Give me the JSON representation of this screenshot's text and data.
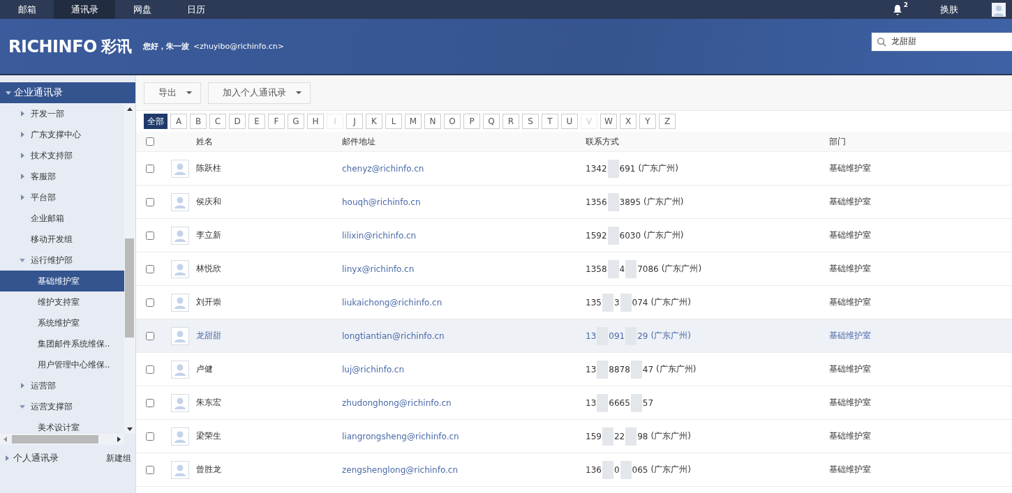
{
  "top_nav": [
    {
      "label": "邮箱",
      "selected": false
    },
    {
      "label": "通讯录",
      "selected": true
    },
    {
      "label": "网盘",
      "selected": false
    },
    {
      "label": "日历",
      "selected": false
    }
  ],
  "notifications": {
    "count": "2"
  },
  "skin_label": "换肤",
  "header": {
    "logo": "RICHINFO",
    "logo_cn": "彩讯",
    "greeting": "您好，朱一波",
    "email": "<zhuyibo@richinfo.cn>"
  },
  "search": {
    "value": "龙甜甜"
  },
  "sidebar": {
    "title": "企业通讯录",
    "expanded": true,
    "items": [
      {
        "label": "开发一部",
        "expanded": false,
        "selected": false
      },
      {
        "label": "广东支撑中心",
        "expanded": false,
        "selected": false
      },
      {
        "label": "技术支持部",
        "expanded": false,
        "selected": false
      },
      {
        "label": "客服部",
        "expanded": false,
        "selected": false
      },
      {
        "label": "平台部",
        "expanded": false,
        "selected": false
      },
      {
        "label": "企业邮箱",
        "selected": false
      },
      {
        "label": "移动开发组",
        "selected": false
      },
      {
        "label": "运行维护部",
        "expanded": true,
        "selected": false,
        "children": [
          {
            "label": "基础维护室",
            "selected": true
          },
          {
            "label": "维护支持室",
            "selected": false
          },
          {
            "label": "系统维护室",
            "selected": false
          },
          {
            "label": "集团邮件系统维保..",
            "selected": false
          },
          {
            "label": "用户管理中心维保..",
            "selected": false
          }
        ]
      },
      {
        "label": "运营部",
        "expanded": false,
        "selected": false
      },
      {
        "label": "运营支撑部",
        "expanded": true,
        "selected": false,
        "children": [
          {
            "label": "美术设计室",
            "selected": false
          }
        ]
      }
    ],
    "personal": {
      "label": "个人通讯录",
      "new_group": "新建组"
    }
  },
  "toolbar": [
    "导出",
    "加入个人通讯录"
  ],
  "letters": [
    {
      "label": "全部",
      "selected": true,
      "disabled": false
    },
    {
      "label": "A",
      "selected": false,
      "disabled": false
    },
    {
      "label": "B",
      "selected": false,
      "disabled": false
    },
    {
      "label": "C",
      "selected": false,
      "disabled": false
    },
    {
      "label": "D",
      "selected": false,
      "disabled": false
    },
    {
      "label": "E",
      "selected": false,
      "disabled": false
    },
    {
      "label": "F",
      "selected": false,
      "disabled": false
    },
    {
      "label": "G",
      "selected": false,
      "disabled": false
    },
    {
      "label": "H",
      "selected": false,
      "disabled": false
    },
    {
      "label": "I",
      "selected": false,
      "disabled": true
    },
    {
      "label": "J",
      "selected": false,
      "disabled": false
    },
    {
      "label": "K",
      "selected": false,
      "disabled": false
    },
    {
      "label": "L",
      "selected": false,
      "disabled": false
    },
    {
      "label": "M",
      "selected": false,
      "disabled": false
    },
    {
      "label": "N",
      "selected": false,
      "disabled": false
    },
    {
      "label": "O",
      "selected": false,
      "disabled": false
    },
    {
      "label": "P",
      "selected": false,
      "disabled": false
    },
    {
      "label": "Q",
      "selected": false,
      "disabled": false
    },
    {
      "label": "R",
      "selected": false,
      "disabled": false
    },
    {
      "label": "S",
      "selected": false,
      "disabled": false
    },
    {
      "label": "T",
      "selected": false,
      "disabled": false
    },
    {
      "label": "U",
      "selected": false,
      "disabled": false
    },
    {
      "label": "V",
      "selected": false,
      "disabled": true
    },
    {
      "label": "W",
      "selected": false,
      "disabled": false
    },
    {
      "label": "X",
      "selected": false,
      "disabled": false
    },
    {
      "label": "Y",
      "selected": false,
      "disabled": false
    },
    {
      "label": "Z",
      "selected": false,
      "disabled": false
    }
  ],
  "table": {
    "columns": [
      "姓名",
      "邮件地址",
      "联系方式",
      "部门"
    ],
    "all_checked": false,
    "rows": [
      {
        "checked": false,
        "selected": false,
        "name": "陈跃柱",
        "email": "chenyz@richinfo.cn",
        "phone": [
          "1342",
          "691"
        ],
        "location": "(广东广州)",
        "dept": "基础维护室"
      },
      {
        "checked": false,
        "selected": false,
        "name": "侯庆和",
        "email": "houqh@richinfo.cn",
        "phone": [
          "1356",
          "3895"
        ],
        "location": "(广东广州)",
        "dept": "基础维护室"
      },
      {
        "checked": false,
        "selected": false,
        "name": "李立新",
        "email": "lilixin@richinfo.cn",
        "phone": [
          "1592",
          "6030"
        ],
        "location": "(广东广州)",
        "dept": "基础维护室"
      },
      {
        "checked": false,
        "selected": false,
        "name": "林悦欣",
        "email": "linyx@richinfo.cn",
        "phone": [
          "1358",
          "4",
          "7086"
        ],
        "location": "(广东广州)",
        "dept": "基础维护室"
      },
      {
        "checked": false,
        "selected": false,
        "name": "刘开崇",
        "email": "liukaichong@richinfo.cn",
        "phone": [
          "135",
          "3",
          "074"
        ],
        "location": "(广东广州)",
        "dept": "基础维护室"
      },
      {
        "checked": false,
        "selected": true,
        "name": "龙甜甜",
        "email": "longtiantian@richinfo.cn",
        "phone": [
          "13",
          "091",
          "29"
        ],
        "location": "(广东广州)",
        "dept": "基础维护室"
      },
      {
        "checked": false,
        "selected": false,
        "name": "卢健",
        "email": "luj@richinfo.cn",
        "phone": [
          "13",
          "8878",
          "47"
        ],
        "location": "(广东广州)",
        "dept": "基础维护室"
      },
      {
        "checked": false,
        "selected": false,
        "name": "朱东宏",
        "email": "zhudonghong@richinfo.cn",
        "phone": [
          "13",
          "6665",
          "57"
        ],
        "dept": "基础维护室"
      },
      {
        "checked": false,
        "selected": false,
        "name": "梁荣生",
        "email": "liangrongsheng@richinfo.cn",
        "phone": [
          "159",
          "22",
          "98"
        ],
        "location": "(广东广州)",
        "dept": "基础维护室"
      },
      {
        "checked": false,
        "selected": false,
        "name": "曾胜龙",
        "email": "zengshenglong@richinfo.cn",
        "phone": [
          "136",
          "0",
          "065"
        ],
        "location": "(广东广州)",
        "dept": "基础维护室"
      }
    ]
  }
}
